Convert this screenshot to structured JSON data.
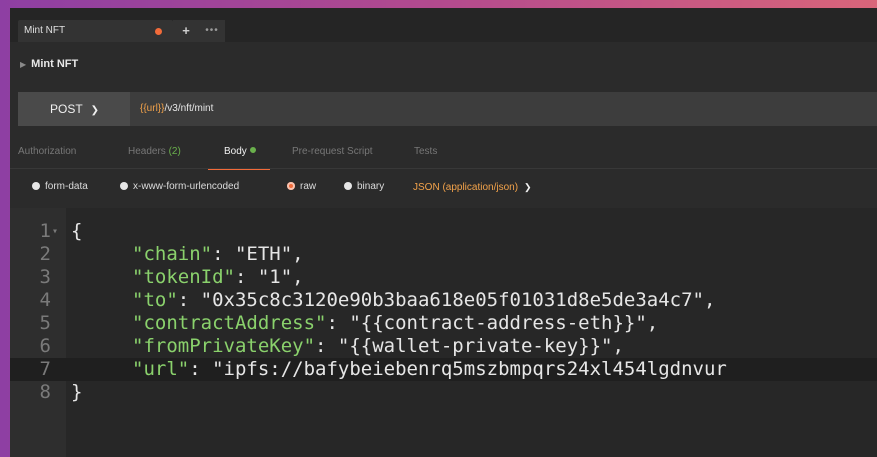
{
  "tab": {
    "title": "Mint NFT",
    "add_label": "+",
    "more_label": "•••"
  },
  "request": {
    "name": "Mint NFT",
    "method": "POST",
    "url_var": "{{url}}",
    "url_path": "/v3/nft/mint"
  },
  "subtabs": {
    "authorization": "Authorization",
    "headers": "Headers",
    "headers_count": "(2)",
    "body": "Body",
    "prerequest": "Pre-request Script",
    "tests": "Tests"
  },
  "body_options": {
    "form_data": "form-data",
    "urlencoded": "x-www-form-urlencoded",
    "raw": "raw",
    "binary": "binary",
    "content_type": "JSON (application/json)",
    "selected": "raw"
  },
  "editor": {
    "lines": [
      {
        "num": "1",
        "key": "",
        "value": "",
        "open": "{"
      },
      {
        "num": "2",
        "key": "\"chain\"",
        "value": "\"ETH\","
      },
      {
        "num": "3",
        "key": "\"tokenId\"",
        "value": "\"1\","
      },
      {
        "num": "4",
        "key": "\"to\"",
        "value": "\"0x35c8c3120e90b3baa618e05f01031d8e5de3a4c7\","
      },
      {
        "num": "5",
        "key": "\"contractAddress\"",
        "value": "\"{{contract-address-eth}}\","
      },
      {
        "num": "6",
        "key": "\"fromPrivateKey\"",
        "value": "\"{{wallet-private-key}}\","
      },
      {
        "num": "7",
        "key": "\"url\"",
        "value": "\"ipfs://bafybeiebenrq5mszbmpqrs24xl454lgdnvur"
      },
      {
        "num": "8",
        "key": "",
        "value": "",
        "close": "}"
      }
    ],
    "colon": ": "
  },
  "colors": {
    "accent": "#f26b3a",
    "var": "#f2a24a",
    "green": "#6ab04c",
    "json_key": "#8ad16c"
  }
}
